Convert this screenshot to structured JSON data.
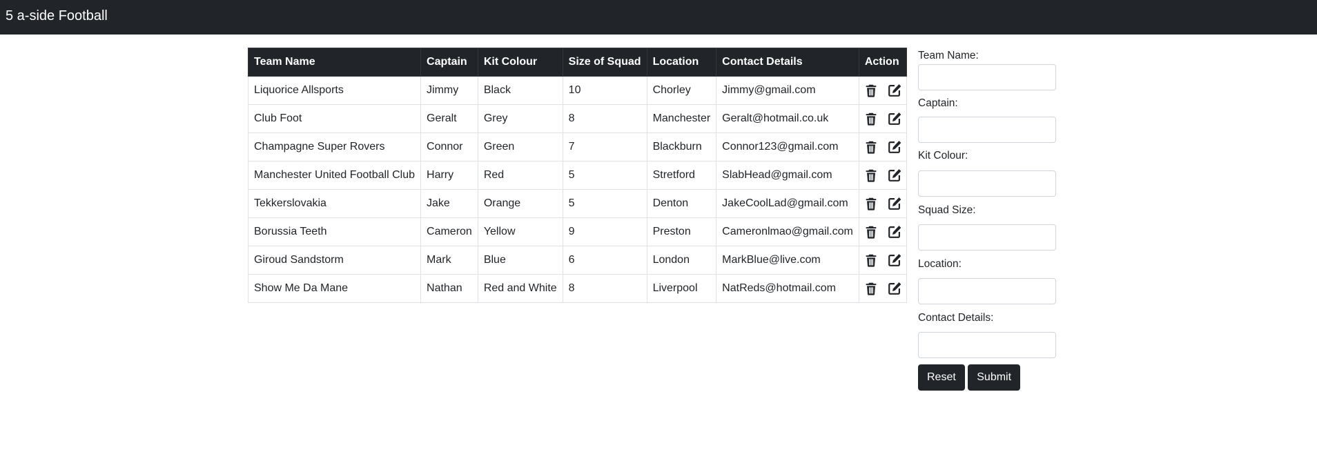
{
  "navbar": {
    "brand": "5 a-side Football"
  },
  "table": {
    "headers": [
      "Team Name",
      "Captain",
      "Kit Colour",
      "Size of Squad",
      "Location",
      "Contact Details",
      "Action"
    ],
    "rows": [
      {
        "team": "Liquorice Allsports",
        "captain": "Jimmy",
        "kit": "Black",
        "squad": "10",
        "location": "Chorley",
        "contact": "Jimmy@gmail.com"
      },
      {
        "team": "Club Foot",
        "captain": "Geralt",
        "kit": "Grey",
        "squad": "8",
        "location": "Manchester",
        "contact": "Geralt@hotmail.co.uk"
      },
      {
        "team": "Champagne Super Rovers",
        "captain": "Connor",
        "kit": "Green",
        "squad": "7",
        "location": "Blackburn",
        "contact": "Connor123@gmail.com"
      },
      {
        "team": "Manchester United Football Club",
        "captain": "Harry",
        "kit": "Red",
        "squad": "5",
        "location": "Stretford",
        "contact": "SlabHead@gmail.com"
      },
      {
        "team": "Tekkerslovakia",
        "captain": "Jake",
        "kit": "Orange",
        "squad": "5",
        "location": "Denton",
        "contact": "JakeCoolLad@gmail.com"
      },
      {
        "team": "Borussia Teeth",
        "captain": "Cameron",
        "kit": "Yellow",
        "squad": "9",
        "location": "Preston",
        "contact": "Cameronlmao@gmail.com"
      },
      {
        "team": "Giroud Sandstorm",
        "captain": "Mark",
        "kit": "Blue",
        "squad": "6",
        "location": "London",
        "contact": "MarkBlue@live.com"
      },
      {
        "team": "Show Me Da Mane",
        "captain": "Nathan",
        "kit": "Red and White",
        "squad": "8",
        "location": "Liverpool",
        "contact": "NatReds@hotmail.com"
      }
    ],
    "action_icons": [
      "trash-icon",
      "edit-icon"
    ]
  },
  "form": {
    "team_name_label": "Team Name:",
    "team_name_value": "",
    "captain_label": "Captain:",
    "captain_value": "",
    "kit_colour_label": "Kit Colour:",
    "kit_colour_value": "",
    "squad_size_label": "Squad Size:",
    "squad_size_value": "",
    "location_label": "Location:",
    "location_value": "",
    "contact_label": "Contact Details:",
    "contact_value": "",
    "reset_label": "Reset",
    "submit_label": "Submit"
  },
  "colors": {
    "navbar_bg": "#212529",
    "header_bg": "#212529",
    "button_bg": "#212529",
    "text": "#212529",
    "border": "#dee2e6"
  }
}
